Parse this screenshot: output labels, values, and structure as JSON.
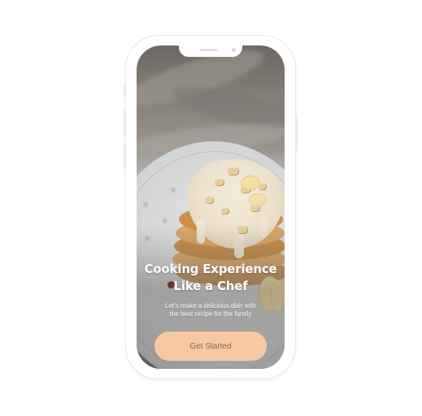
{
  "onboarding": {
    "headline_line1": "Cooking Experience",
    "headline_line2": "Like a Chef",
    "subtitle_line1": "Let’s  make a delicious dish with",
    "subtitle_line2": "the best recipe  for the family",
    "cta_label": "Get Started"
  },
  "colors": {
    "cta_background": "#f6c9a4",
    "cta_text": "#7d6a5b",
    "text": "#ffffff"
  },
  "decoration": {
    "sparkle_glyph": "✳"
  }
}
